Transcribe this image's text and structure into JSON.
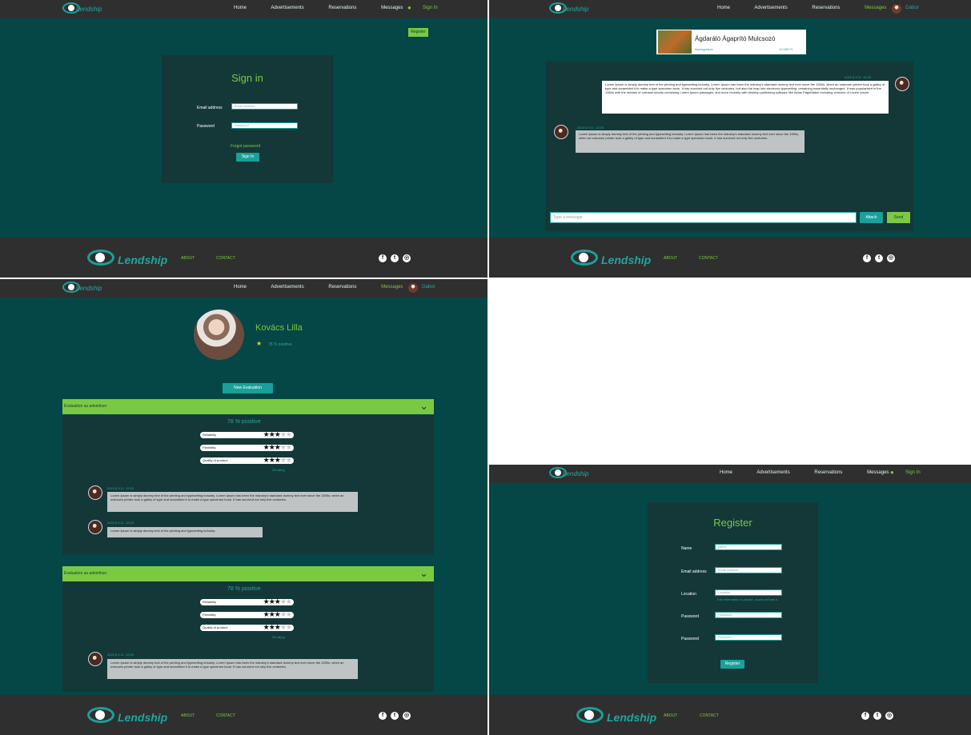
{
  "signin": {
    "brand": "Lendship",
    "nav": [
      "Home",
      "Advertisements",
      "Reservations",
      "Messages"
    ],
    "signin_label": "Sign In",
    "register_button": "Register",
    "title": "Sign in",
    "email_label": "Email address",
    "email_placeholder": "Email address",
    "password_label": "Password",
    "password_placeholder": "Password",
    "forgot": "Forgot password",
    "submit": "Sign In",
    "footer": {
      "about": "ABOUT",
      "contact": "CONTACT"
    }
  },
  "messages": {
    "brand": "Lendship",
    "nav": [
      "Home",
      "Advertisements",
      "Reservations",
      "Messages"
    ],
    "user": "Gábor",
    "item_title": "Ágdaráló Ágaprító Mulcsozó",
    "item_location": "Nyíregyháza",
    "item_price": "10 000 Ft",
    "msg1_time": "2022.6.3 11. 12:03",
    "msg1_text": "Lorem Ipsum is simply dummy text of the printing and typesetting industry. Lorem Ipsum has been the industry's standard dummy text ever since the 1500s, when an unknown printer took a galley of type and scrambled it to make a type specimen book. It has survived not only five centuries, but also the leap into electronic typesetting, remaining essentially unchanged. It was popularised in the 1960s with the release of Letraset sheets containing Lorem Ipsum passages, and more recently with desktop publishing software like Aldus PageMaker including versions of Lorem Ipsum.",
    "msg2_time": "2022.6.3 11. 12:03",
    "msg2_text": "Lorem Ipsum is simply dummy text of the printing and typesetting industry. Lorem Ipsum has been the industry's standard dummy text ever since the 1500s, when an unknown printer took a galley of type and scrambled it to make a type specimen book. It has survived not only five centuries.",
    "input_placeholder": "Type a message",
    "attach": "Attach",
    "send": "Send",
    "footer": {
      "about": "ABOUT",
      "contact": "CONTACT"
    }
  },
  "profile": {
    "brand": "Lendship",
    "nav": [
      "Home",
      "Advertisements",
      "Reservations",
      "Messages"
    ],
    "user": "Gábor",
    "name": "Kovács Lilla",
    "positive": "78 % positive",
    "new_eval": "New Evaluation",
    "sections": [
      {
        "title": "Evaluation as advertiser",
        "summary": "78 % positive",
        "ratings": [
          {
            "label": "Reliability",
            "stars": 3
          },
          {
            "label": "Flexibility",
            "stars": 3
          },
          {
            "label": "Quality of product",
            "stars": 3
          }
        ],
        "count": "28 rating",
        "comments": [
          {
            "time": "2022.6.3 11. 12:03",
            "text": "Lorem Ipsum is simply dummy text of the printing and typesetting industry. Lorem Ipsum has been the industry's standard dummy text ever since the 1500s, when an unknown printer took a galley of type and scrambled it to make a type specimen book. It has survived not only five centuries."
          },
          {
            "time": "2022.6.3 11. 12:03",
            "text": "Lorem Ipsum is simply dummy text of the printing and typesetting industry."
          }
        ]
      },
      {
        "title": "Evaluation as advertiser",
        "summary": "78 % positive",
        "ratings": [
          {
            "label": "Reliability",
            "stars": 3
          },
          {
            "label": "Flexibility",
            "stars": 3
          },
          {
            "label": "Quality of product",
            "stars": 3
          }
        ],
        "count": "28 rating",
        "comments": [
          {
            "time": "2022.6.3 11. 12:03",
            "text": "Lorem Ipsum is simply dummy text of the printing and typesetting industry. Lorem Ipsum has been the industry's standard dummy text ever since the 1500s, when an unknown printer took a galley of type and scrambled it to make a type specimen book. It has survived not only five centuries."
          }
        ]
      }
    ],
    "footer": {
      "about": "ABOUT",
      "contact": "CONTACT"
    }
  },
  "register": {
    "brand": "Lendship",
    "nav": [
      "Home",
      "Advertisements",
      "Reservations",
      "Messages"
    ],
    "signin_label": "Sign In",
    "title": "Register",
    "name_label": "Name",
    "name_placeholder": "Name",
    "email_label": "Email address",
    "email_placeholder": "Email address",
    "location_label": "Location",
    "location_placeholder": "Location",
    "location_hint": "This information is private, noone will see it.",
    "password_label": "Password",
    "password_placeholder": "Password",
    "password2_label": "Password",
    "password2_placeholder": "Password",
    "submit": "Register",
    "footer": {
      "about": "ABOUT",
      "contact": "CONTACT"
    }
  },
  "colors": {
    "bg": "#054646",
    "nav": "#2f2f2f",
    "accent_green": "#7ac943",
    "accent_teal": "#1aa09a"
  }
}
